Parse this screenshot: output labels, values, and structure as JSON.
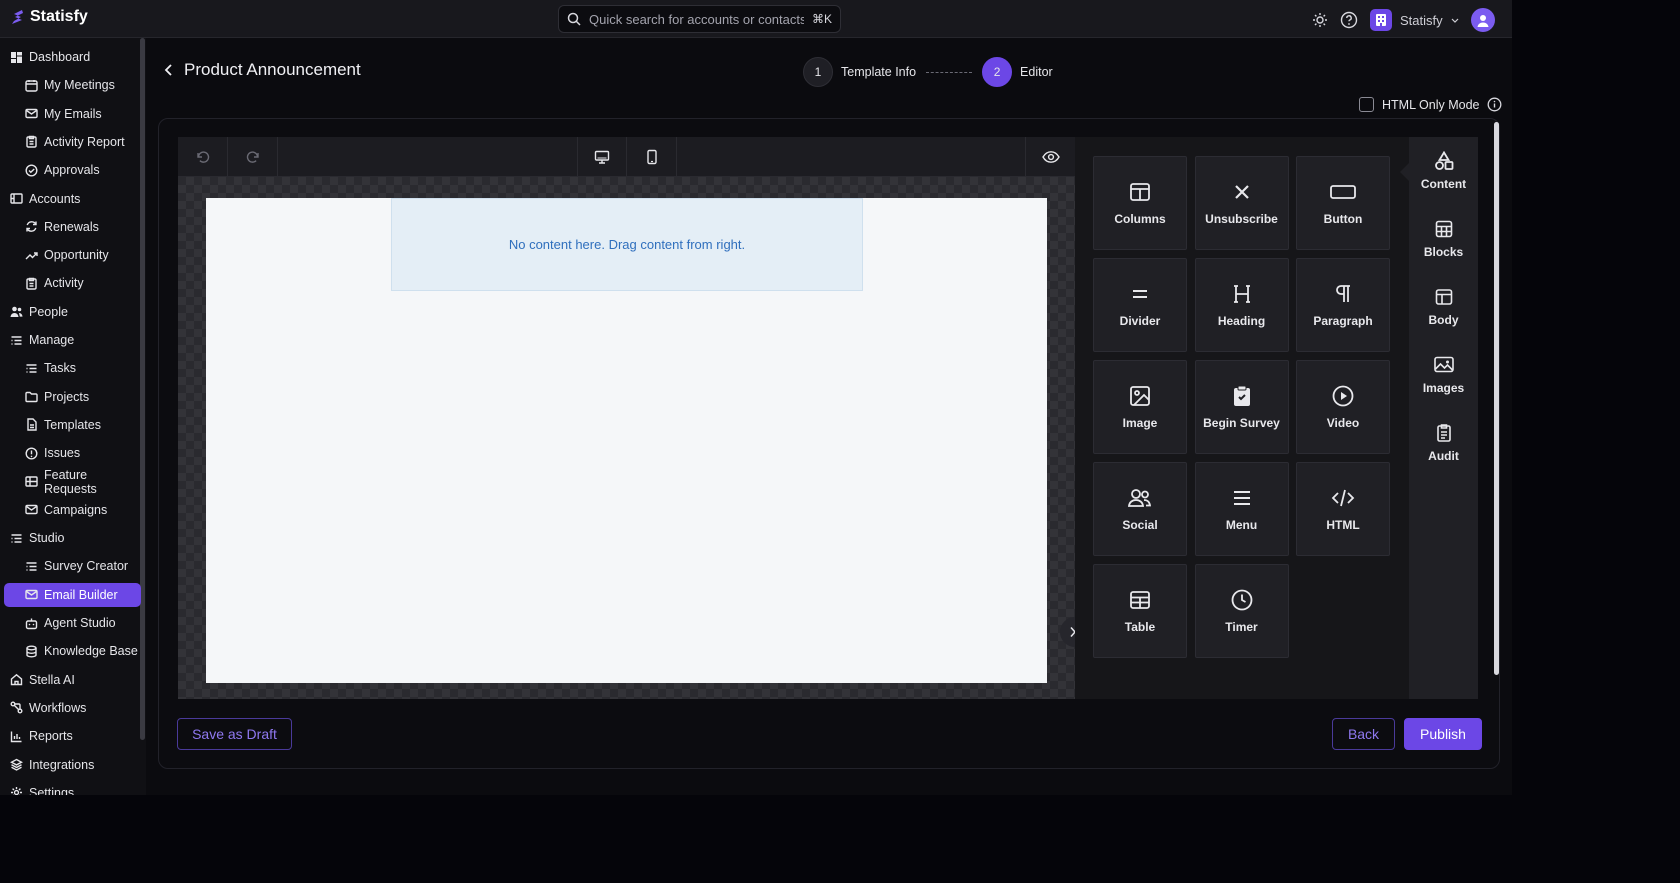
{
  "app": {
    "name": "Statisfy",
    "org_label": "Statisfy",
    "search_placeholder": "Quick search for accounts or contacts",
    "search_shortcut": "⌘K"
  },
  "sidebar": {
    "items": [
      {
        "label": "Dashboard",
        "icon": "dashboard-icon"
      },
      {
        "label": "My Meetings",
        "icon": "calendar-icon"
      },
      {
        "label": "My Emails",
        "icon": "mail-icon"
      },
      {
        "label": "Activity Report",
        "icon": "clipboard-icon"
      },
      {
        "label": "Approvals",
        "icon": "check-circle-icon"
      },
      {
        "label": "Accounts",
        "icon": "accounts-icon"
      },
      {
        "label": "Renewals",
        "icon": "refresh-icon"
      },
      {
        "label": "Opportunity",
        "icon": "trend-icon"
      },
      {
        "label": "Activity",
        "icon": "clipboard-icon"
      },
      {
        "label": "People",
        "icon": "people-icon"
      },
      {
        "label": "Manage",
        "icon": "list-icon"
      },
      {
        "label": "Tasks",
        "icon": "list-icon"
      },
      {
        "label": "Projects",
        "icon": "folder-icon"
      },
      {
        "label": "Templates",
        "icon": "file-icon"
      },
      {
        "label": "Issues",
        "icon": "alert-icon"
      },
      {
        "label": "Feature Requests",
        "icon": "grid-icon"
      },
      {
        "label": "Campaigns",
        "icon": "mail-icon"
      },
      {
        "label": "Studio",
        "icon": "list-icon"
      },
      {
        "label": "Survey Creator",
        "icon": "list-icon"
      },
      {
        "label": "Email Builder",
        "icon": "mail-icon"
      },
      {
        "label": "Agent Studio",
        "icon": "bot-icon"
      },
      {
        "label": "Knowledge Base",
        "icon": "database-icon"
      },
      {
        "label": "Stella AI",
        "icon": "home-icon"
      },
      {
        "label": "Workflows",
        "icon": "workflow-icon"
      },
      {
        "label": "Reports",
        "icon": "chart-icon"
      },
      {
        "label": "Integrations",
        "icon": "layers-icon"
      },
      {
        "label": "Settings",
        "icon": "gear-icon"
      }
    ]
  },
  "header": {
    "title": "Product Announcement",
    "steps": [
      {
        "num": "1",
        "label": "Template Info"
      },
      {
        "num": "2",
        "label": "Editor"
      }
    ],
    "html_only_mode": "HTML Only Mode"
  },
  "editor": {
    "dropzone_text": "No content here. Drag content from right."
  },
  "tools": [
    {
      "label": "Columns",
      "icon": "columns-icon"
    },
    {
      "label": "Unsubscribe",
      "icon": "x-icon"
    },
    {
      "label": "Button",
      "icon": "button-icon"
    },
    {
      "label": "Divider",
      "icon": "divider-icon"
    },
    {
      "label": "Heading",
      "icon": "heading-icon"
    },
    {
      "label": "Paragraph",
      "icon": "paragraph-icon"
    },
    {
      "label": "Image",
      "icon": "image-icon"
    },
    {
      "label": "Begin Survey",
      "icon": "clipboard-check-icon"
    },
    {
      "label": "Video",
      "icon": "play-icon"
    },
    {
      "label": "Social",
      "icon": "social-icon"
    },
    {
      "label": "Menu",
      "icon": "menu-icon"
    },
    {
      "label": "HTML",
      "icon": "code-icon"
    },
    {
      "label": "Table",
      "icon": "table-icon"
    },
    {
      "label": "Timer",
      "icon": "clock-icon"
    }
  ],
  "tabs": [
    {
      "label": "Content",
      "icon": "shapes-icon"
    },
    {
      "label": "Blocks",
      "icon": "blocks-icon"
    },
    {
      "label": "Body",
      "icon": "body-icon"
    },
    {
      "label": "Images",
      "icon": "images-icon"
    },
    {
      "label": "Audit",
      "icon": "audit-icon"
    }
  ],
  "footer": {
    "save_draft": "Save as Draft",
    "back": "Back",
    "publish": "Publish"
  },
  "colors": {
    "accent": "#6c47e6",
    "background": "#0b0b0f",
    "dropzone_text": "#2f6fbd"
  }
}
